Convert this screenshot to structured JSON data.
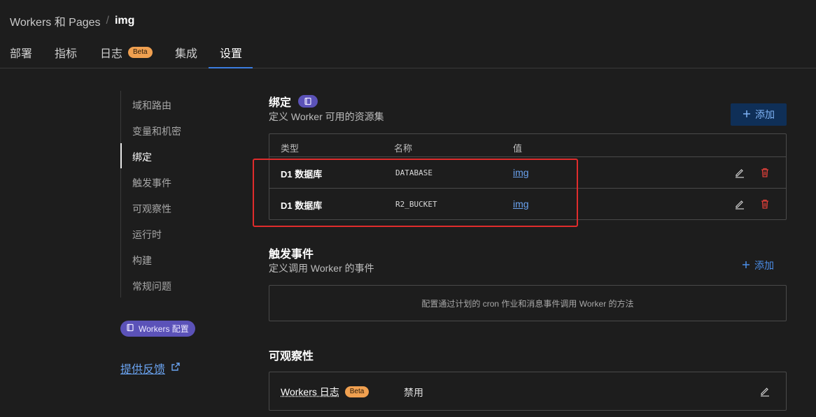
{
  "breadcrumb": {
    "parent": "Workers 和 Pages",
    "separator": "/",
    "current": "img"
  },
  "tabs": [
    {
      "label": "部署"
    },
    {
      "label": "指标"
    },
    {
      "label": "日志",
      "badge": "Beta"
    },
    {
      "label": "集成"
    },
    {
      "label": "设置",
      "active": true
    }
  ],
  "side_nav": {
    "items": [
      {
        "label": "域和路由"
      },
      {
        "label": "变量和机密"
      },
      {
        "label": "绑定",
        "active": true
      },
      {
        "label": "触发事件"
      },
      {
        "label": "可观察性"
      },
      {
        "label": "运行时"
      },
      {
        "label": "构建"
      },
      {
        "label": "常规问题"
      }
    ],
    "config_pill": "Workers 配置",
    "feedback_link": "提供反馈"
  },
  "bindings": {
    "title": "绑定",
    "description": "定义 Worker 可用的资源集",
    "add_label": "添加",
    "columns": [
      "类型",
      "名称",
      "值"
    ],
    "rows": [
      {
        "type": "D1 数据库",
        "name": "DATABASE",
        "value": "img"
      },
      {
        "type": "D1 数据库",
        "name": "R2_BUCKET",
        "value": "img"
      }
    ]
  },
  "triggers": {
    "title": "触发事件",
    "description": "定义调用 Worker 的事件",
    "add_label": "添加",
    "empty_text": "配置通过计划的 cron 作业和消息事件调用 Worker 的方法"
  },
  "observability": {
    "title": "可观察性",
    "label": "Workers 日志",
    "badge": "Beta",
    "value": "禁用"
  },
  "colors": {
    "accent": "#3b7de0",
    "link": "#6aa3f0",
    "badge_orange": "#f0a050",
    "delete_red": "#e0403a",
    "highlight_red": "#e02c2c",
    "purple": "#5b52b8"
  }
}
